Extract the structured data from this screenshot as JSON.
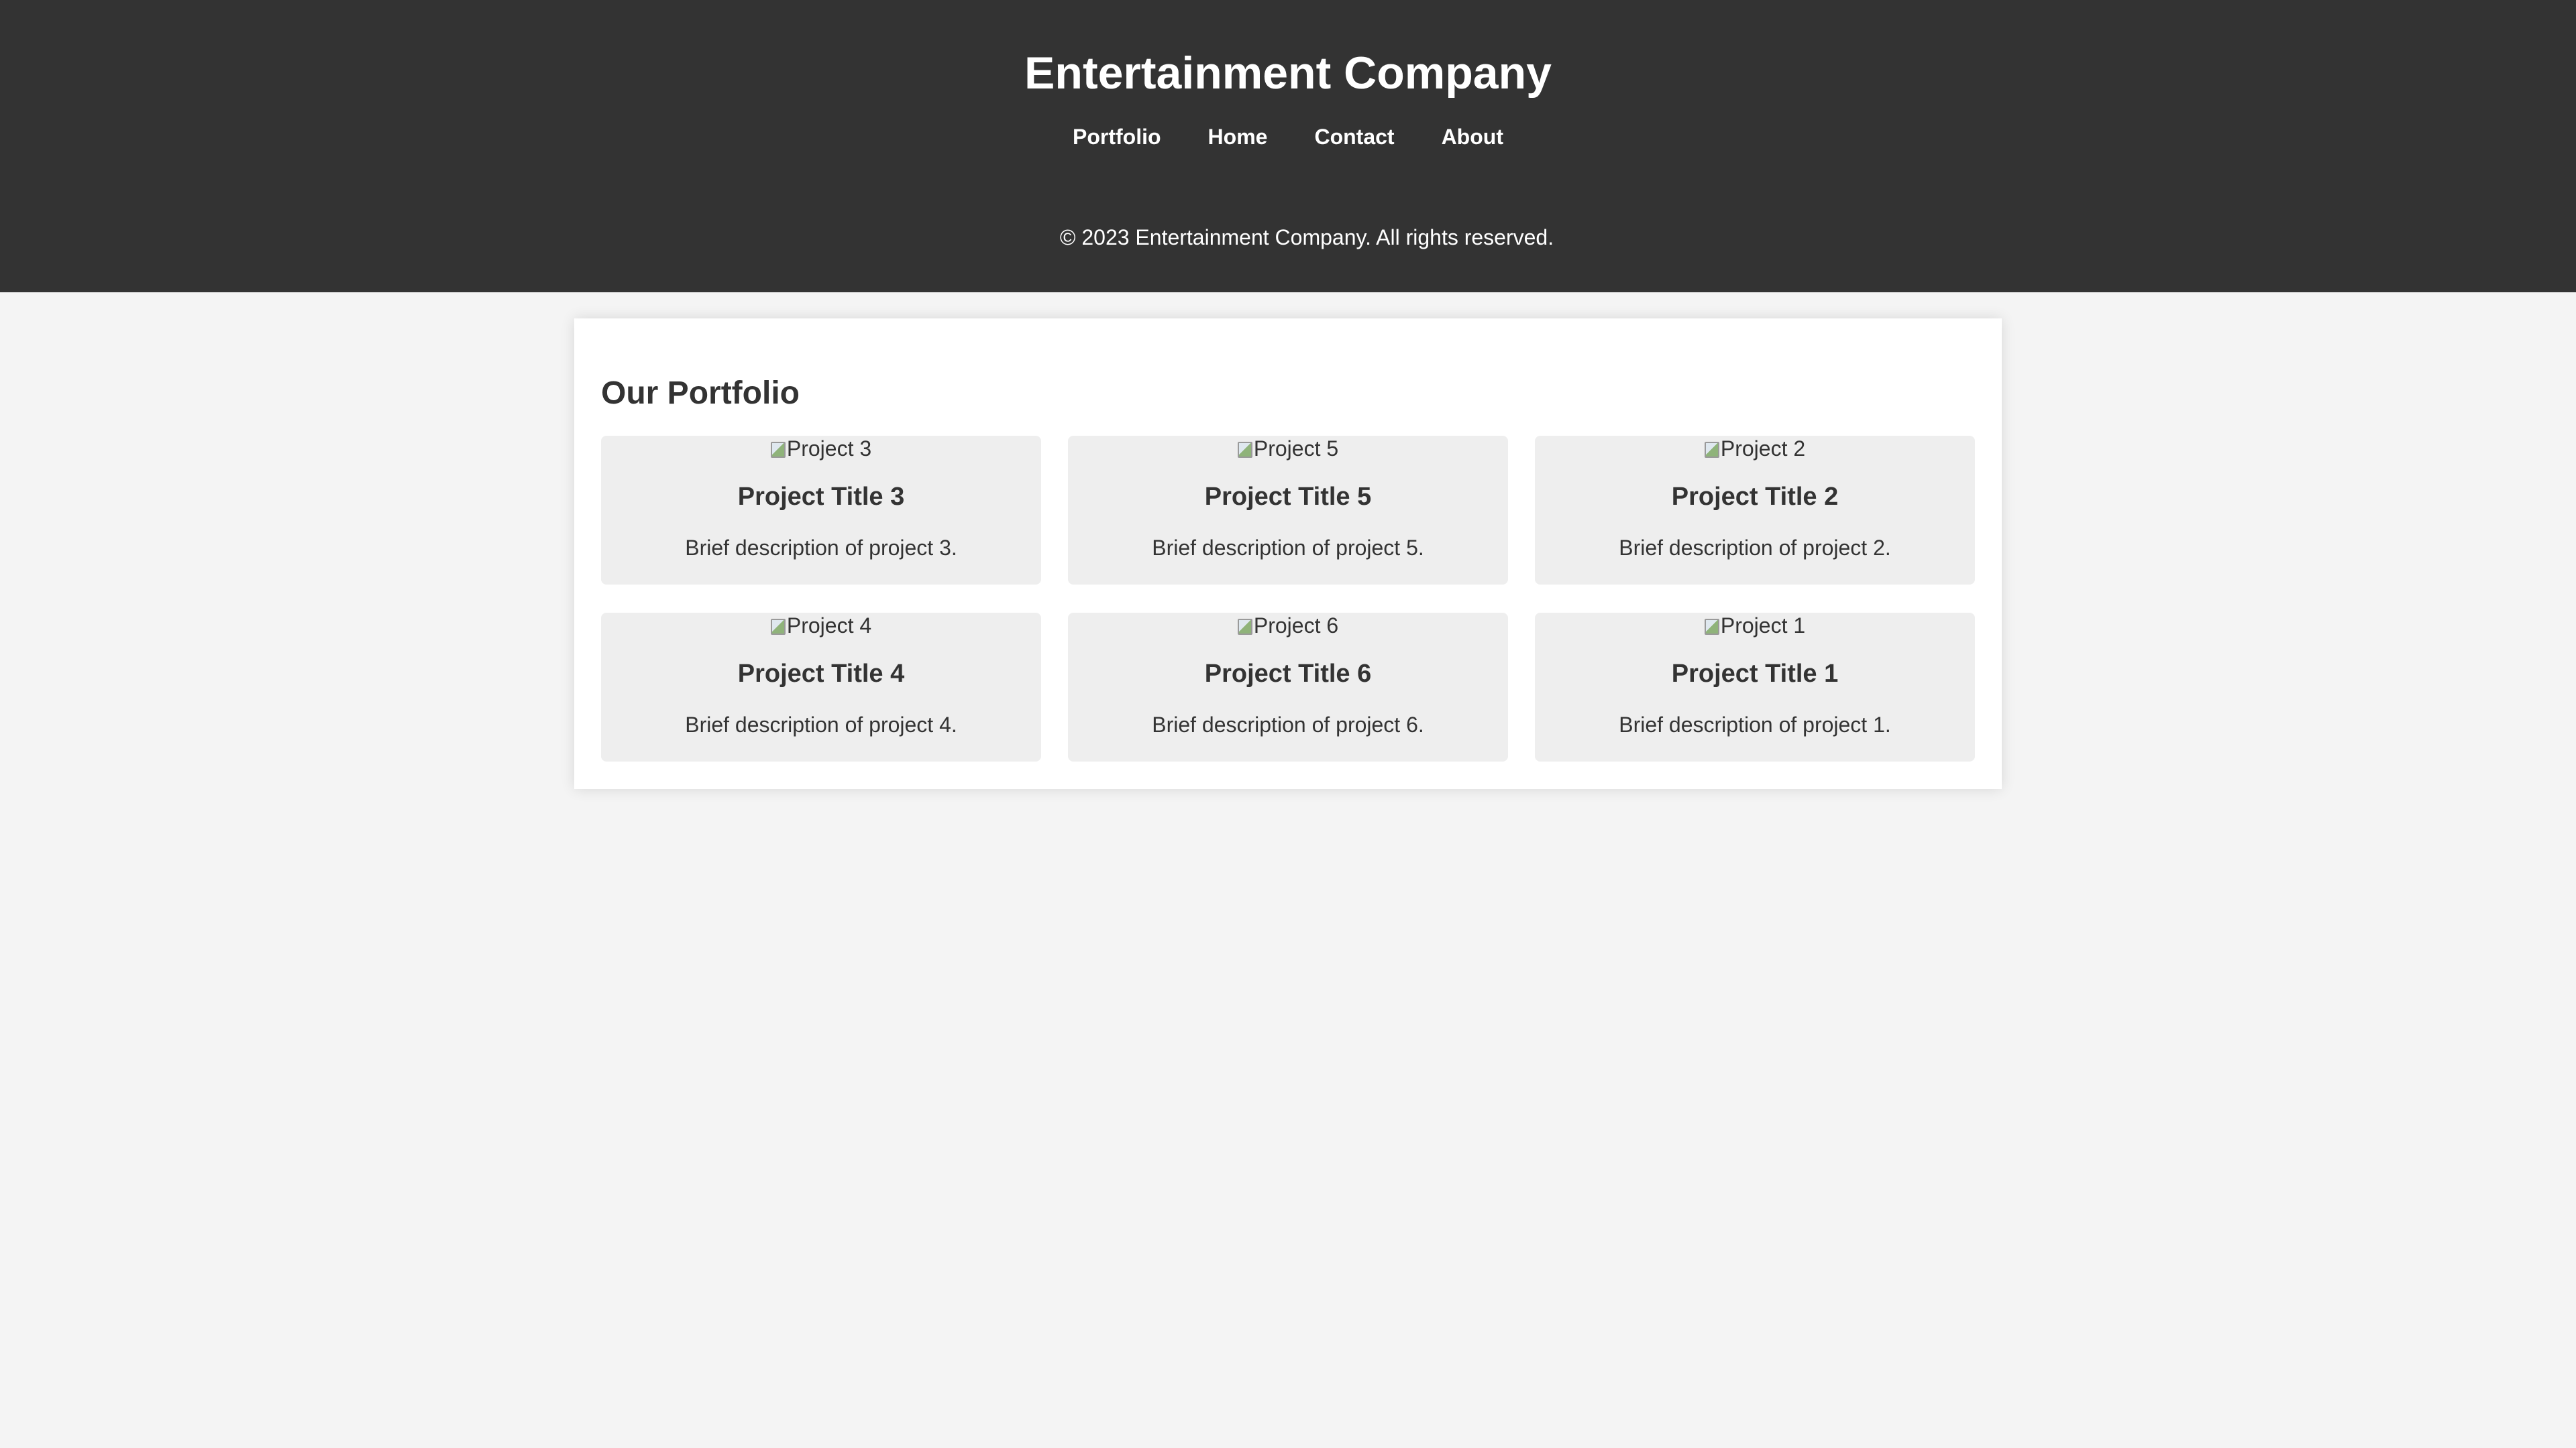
{
  "header": {
    "title": "Entertainment Company",
    "nav": [
      {
        "label": "Portfolio"
      },
      {
        "label": "Home"
      },
      {
        "label": "Contact"
      },
      {
        "label": "About"
      }
    ],
    "copyright": "© 2023 Entertainment Company. All rights reserved."
  },
  "portfolio": {
    "heading": "Our Portfolio",
    "projects": [
      {
        "image_alt": "Project 3",
        "title": "Project Title 3",
        "description": "Brief description of project 3."
      },
      {
        "image_alt": "Project 5",
        "title": "Project Title 5",
        "description": "Brief description of project 5."
      },
      {
        "image_alt": "Project 2",
        "title": "Project Title 2",
        "description": "Brief description of project 2."
      },
      {
        "image_alt": "Project 4",
        "title": "Project Title 4",
        "description": "Brief description of project 4."
      },
      {
        "image_alt": "Project 6",
        "title": "Project Title 6",
        "description": "Brief description of project 6."
      },
      {
        "image_alt": "Project 1",
        "title": "Project Title 1",
        "description": "Brief description of project 1."
      }
    ]
  },
  "colors": {
    "header_background": "#333333",
    "page_background": "#f4f4f4",
    "panel_background": "#ffffff",
    "card_background": "#eeeeee",
    "text": "#333333"
  },
  "icons": {
    "broken_image": "broken-image-icon"
  }
}
